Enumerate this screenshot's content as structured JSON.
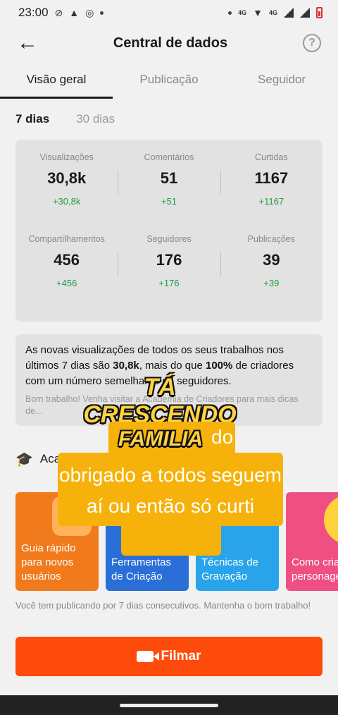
{
  "status_bar": {
    "time": "23:00",
    "left_icons": [
      "circle-slash-icon",
      "warning-icon",
      "whatsapp-icon",
      "dot-icon"
    ],
    "right_icons": [
      "dot-icon",
      "4g-icon",
      "wifi-icon",
      "4g-icon",
      "signal-icon",
      "signal-icon",
      "battery-low-icon"
    ],
    "net1": "4G",
    "net2": "4G"
  },
  "header": {
    "title": "Central de dados",
    "help": "?"
  },
  "tabs": [
    {
      "label": "Visão geral",
      "active": true
    },
    {
      "label": "Publicação",
      "active": false
    },
    {
      "label": "Seguidor",
      "active": false
    }
  ],
  "periods": [
    {
      "label": "7 dias",
      "active": true
    },
    {
      "label": "30 dias",
      "active": false
    }
  ],
  "stats": [
    {
      "label": "Visualizações",
      "value": "30,8k",
      "delta": "+30,8k"
    },
    {
      "label": "Comentários",
      "value": "51",
      "delta": "+51"
    },
    {
      "label": "Curtidas",
      "value": "1167",
      "delta": "+1167"
    },
    {
      "label": "Compartilhamentos",
      "value": "456",
      "delta": "+456"
    },
    {
      "label": "Seguidores",
      "value": "176",
      "delta": "+176"
    },
    {
      "label": "Publicações",
      "value": "39",
      "delta": "+39"
    }
  ],
  "info": {
    "text_a": "As novas visualizações de todos os seus trabalhos nos últimos 7 dias são ",
    "bold_a": "30,8k",
    "text_b": ", mais do que ",
    "bold_b": "100%",
    "text_c": " de criadores com um número semelhante de seguidores.",
    "sub": "Bom trabalho! Venha visitar a Academia de Criadores para mais dicas de..."
  },
  "academy": {
    "title": "Academia"
  },
  "cards": [
    {
      "label": "Guia rápido para novos usuários",
      "color": "#f07a1c"
    },
    {
      "label": "Ferramentas de Criação",
      "color": "#2a6fd8"
    },
    {
      "label": "Técnicas de Gravação",
      "color": "#29a4ea"
    },
    {
      "label": "Como criar personagens",
      "color": "#ef4f82"
    }
  ],
  "streak_text": "Você tem publicando por 7 dias consecutivos. Mantenha o bom trabalho!",
  "film_button": "Filmar",
  "overlay": {
    "line1": "TÁ CRESCENDO",
    "line2": "FAMILIA",
    "line2_suffix": "do",
    "body": "obrigado a todos seguem aí ou então só curti"
  },
  "accent_color": "#fe4a0b",
  "positive_color": "#1f9d3f"
}
